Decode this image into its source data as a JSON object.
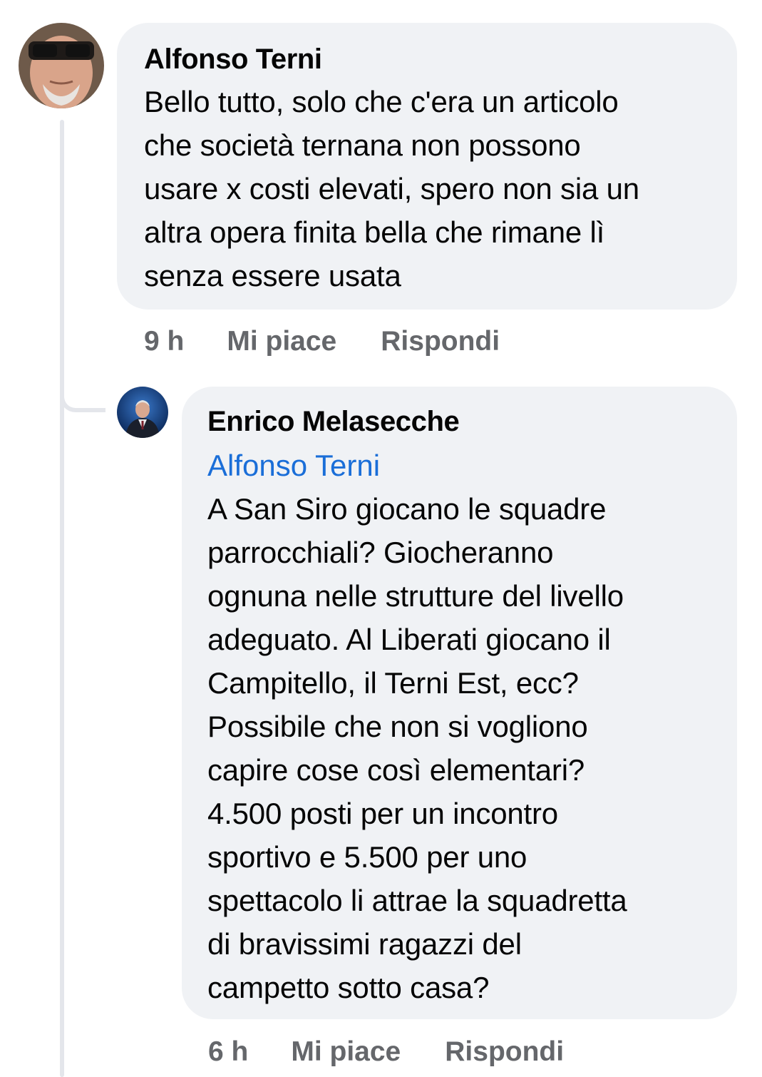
{
  "comment": {
    "author": "Alfonso Terni",
    "avatar_icon": "user-photo-avatar",
    "text": "Bello tutto, solo che c'era un articolo\nche società ternana non possono\nusare x costi elevati, spero non sia un\naltra opera finita bella che rimane lì\nsenza essere usata",
    "time": "9 h",
    "like_label": "Mi piace",
    "reply_label": "Rispondi"
  },
  "reply": {
    "author": "Enrico Melasecche",
    "avatar_icon": "user-photo-avatar",
    "mention": "Alfonso Terni",
    "text": "A San Siro giocano le squadre\nparrocchiali? Giocheranno\nognuna nelle strutture del livello\nadeguato. Al Liberati giocano il\nCampitello, il Terni Est, ecc?\nPossibile che non si vogliono\ncapire cose così elementari?\n4.500 posti per un incontro\nsportivo e 5.500 per uno\nspettacolo li attrae la squadretta\ndi bravissimi ragazzi del\ncampetto sotto casa?",
    "time": "6 h",
    "like_label": "Mi piace",
    "reply_label": "Rispondi"
  },
  "colors": {
    "bubble_bg": "#f0f2f5",
    "mention_link": "#1a6ed8",
    "meta_text": "#65676b",
    "thread_line": "#e4e6eb"
  }
}
